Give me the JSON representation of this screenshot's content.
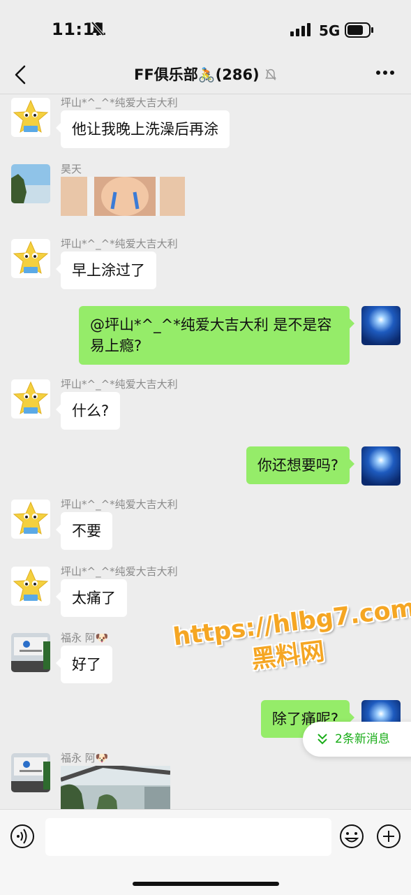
{
  "status_bar": {
    "time": "11:11",
    "network": "5G"
  },
  "header": {
    "title": "FF俱乐部",
    "title_emoji": "🚴",
    "member_count": "(286)"
  },
  "messages": [
    {
      "sender": "坪山*^_^*纯爱大吉大利",
      "text": "他让我晚上洗澡后再涂"
    },
    {
      "sender": "昊天",
      "type": "image"
    },
    {
      "sender": "坪山*^_^*纯爱大吉大利",
      "text": "早上涂过了"
    },
    {
      "self": true,
      "text_line1": "@坪山*^_^*纯爱大吉大利 是不是容",
      "text_line2": "易上瘾?"
    },
    {
      "sender": "坪山*^_^*纯爱大吉大利",
      "text": "什么?"
    },
    {
      "self": true,
      "text": "你还想要吗?"
    },
    {
      "sender": "坪山*^_^*纯爱大吉大利",
      "text": "不要"
    },
    {
      "sender": "坪山*^_^*纯爱大吉大利",
      "text": "太痛了"
    },
    {
      "sender": "福永 阿🐶",
      "text": "好了"
    },
    {
      "self": true,
      "text": "除了痛呢?"
    },
    {
      "sender": "福永 阿🐶",
      "type": "image"
    }
  ],
  "watermark": {
    "line1": "https://hlbg7.com",
    "line2": "黑料网"
  },
  "new_messages_badge": "2条新消息",
  "colors": {
    "background": "#ededed",
    "self_bubble": "#95ec69",
    "other_bubble": "#ffffff",
    "accent_green": "#1aad19",
    "watermark": "#f5a623"
  }
}
